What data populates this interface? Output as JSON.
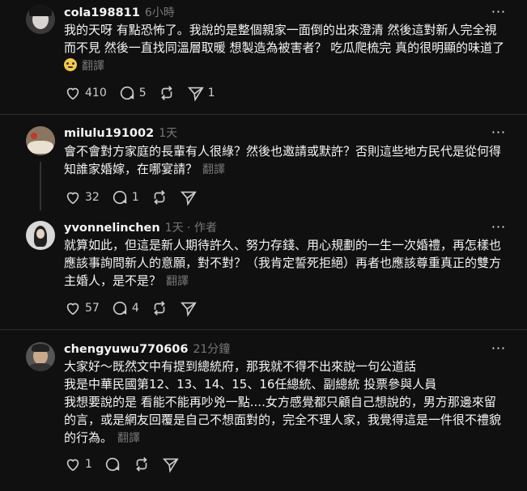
{
  "comments": [
    {
      "username": "cola198811",
      "time": "6小時",
      "lines": [
        "我的天呀 有點恐怖了。我說的是整個親家一面倒的出來澄清 然後這對新人完全視",
        "而不見 然後一直找同溫層取暖 想製造為被害者？ 吃瓜爬梳完 真的很明顯的味道了"
      ],
      "translate": "翻譯",
      "likes": "410",
      "replies": "5",
      "shares": "1"
    },
    {
      "username": "milulu191002",
      "time": "1天",
      "lines": [
        "會不會對方家庭的長輩有人很綠？然後也邀請或默許？否則這些地方民代是從何得",
        "知誰家婚嫁，在哪宴請？"
      ],
      "translate": "翻譯",
      "likes": "32",
      "replies": "1"
    },
    {
      "username": "yvonnelinchen",
      "time": "1天",
      "author_tag": "作者",
      "lines": [
        "就算如此，但這是新人期待許久、努力存錢、用心規劃的一生一次婚禮，再怎樣也",
        "應該事詢問新人的意願，對不對？（我肯定誓死拒絕）再者也應該尊重真正的雙方",
        "主婚人，是不是？"
      ],
      "translate": "翻譯",
      "likes": "57",
      "replies": "4"
    },
    {
      "username": "chengyuwu770606",
      "time": "21分鐘",
      "lines": [
        "大家好～既然文中有提到總統府，那我就不得不出來說一句公道話",
        "我是中華民國第12、13、14、15、16任總統、副總統 投票參與人員",
        "我想要說的是 看能不能再吵兇一點....女方感覺都只顧自己想說的，男方那邊來留",
        "的言，或是網友回覆是自己不想面對的，完全不理人家，我覺得這是一件很不禮貌",
        "的行為。"
      ],
      "translate": "翻譯",
      "likes": "1"
    }
  ],
  "more_label": "···"
}
